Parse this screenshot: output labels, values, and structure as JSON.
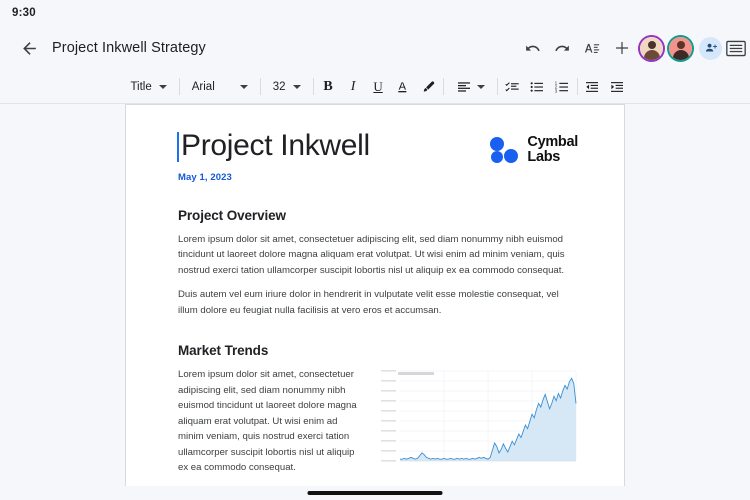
{
  "status_bar": {
    "time": "9:30"
  },
  "app_bar": {
    "back_icon": "back-arrow-icon",
    "title": "Project Inkwell Strategy",
    "actions": [
      {
        "name": "undo-button",
        "icon": "undo-icon"
      },
      {
        "name": "redo-button",
        "icon": "redo-icon"
      },
      {
        "name": "text-format-button",
        "icon": "text-format-icon"
      },
      {
        "name": "add-button",
        "icon": "plus-icon"
      }
    ],
    "collaborators": [
      {
        "name": "collaborator-avatar-1",
        "ring_color": "#9334c6"
      },
      {
        "name": "collaborator-avatar-2",
        "ring_color": "#0f9b8e"
      }
    ],
    "add_person": {
      "name": "add-person-button",
      "icon": "person-add-icon",
      "bg": "#d7e7fb"
    },
    "overflow": {
      "name": "document-outline-button",
      "icon": "list-menu-icon"
    }
  },
  "format_toolbar": {
    "style_select": {
      "value": "Title"
    },
    "font_select": {
      "value": "Arial"
    },
    "size_select": {
      "value": "32"
    },
    "buttons": [
      {
        "name": "bold-button",
        "label": "B"
      },
      {
        "name": "italic-button",
        "label": "I"
      },
      {
        "name": "underline-button",
        "label": "U"
      },
      {
        "name": "text-color-button",
        "label": "A"
      },
      {
        "name": "highlight-button",
        "label": "highlighter-icon"
      },
      {
        "name": "align-button",
        "label": "align-left-icon"
      },
      {
        "name": "checklist-button",
        "label": "checklist-icon"
      },
      {
        "name": "bulleted-list-button",
        "label": "bulleted-list-icon"
      },
      {
        "name": "numbered-list-button",
        "label": "numbered-list-icon"
      },
      {
        "name": "decrease-indent-button",
        "label": "decrease-indent-icon"
      },
      {
        "name": "increase-indent-button",
        "label": "increase-indent-icon"
      }
    ]
  },
  "document": {
    "heading": "Project Inkwell",
    "date": "May 1, 2023",
    "logo": {
      "text_line1": "Cymbal",
      "text_line2": "Labs",
      "color": "#1a60f0"
    },
    "sections": [
      {
        "heading": "Project Overview",
        "paragraphs": [
          "Lorem ipsum dolor sit amet, consectetuer adipiscing elit, sed diam nonummy nibh euismod tincidunt ut laoreet dolore magna aliquam erat volutpat. Ut wisi enim ad minim veniam, quis nostrud exerci tation ullamcorper suscipit lobortis nisl ut aliquip ex ea commodo consequat.",
          "Duis autem vel eum iriure dolor in hendrerit in vulputate velit esse molestie consequat, vel illum dolore eu feugiat nulla facilisis at vero eros et accumsan."
        ]
      },
      {
        "heading": "Market Trends",
        "paragraphs": [
          "Lorem ipsum dolor sit amet, consectetuer adipiscing elit, sed diam nonummy nibh euismod tincidunt ut laoreet dolore magna aliquam erat volutpat. Ut wisi enim ad minim veniam, quis nostrud exerci tation ullamcorper suscipit lobortis nisl ut aliquip ex ea commodo consequat."
        ]
      }
    ]
  },
  "chart_data": {
    "type": "area",
    "title": "",
    "xlabel": "",
    "ylabel": "",
    "grid": true,
    "legend_position": "top-left",
    "line_color": "#3b8fd4",
    "fill_color": "#cfe4f5",
    "x": [
      0,
      1,
      2,
      3,
      4,
      5,
      6,
      7,
      8,
      9,
      10,
      11,
      12,
      13,
      14,
      15,
      16,
      17,
      18,
      19,
      20,
      21,
      22,
      23,
      24,
      25,
      26,
      27,
      28,
      29,
      30,
      31,
      32,
      33,
      34,
      35,
      36,
      37,
      38,
      39,
      40,
      41,
      42,
      43,
      44,
      45,
      46,
      47,
      48,
      49,
      50,
      51,
      52,
      53,
      54,
      55,
      56,
      57,
      58,
      59,
      60,
      61,
      62,
      63,
      64,
      65,
      66,
      67,
      68,
      69,
      70,
      71,
      72,
      73,
      74,
      75,
      76,
      77,
      78,
      79,
      80
    ],
    "values": [
      2,
      2,
      3,
      2,
      3,
      4,
      3,
      2,
      3,
      6,
      9,
      7,
      4,
      3,
      2,
      3,
      2,
      3,
      2,
      2,
      3,
      2,
      2,
      3,
      2,
      2,
      3,
      2,
      3,
      2,
      3,
      2,
      2,
      3,
      2,
      3,
      4,
      3,
      4,
      3,
      2,
      4,
      12,
      20,
      16,
      9,
      13,
      19,
      14,
      10,
      16,
      22,
      18,
      24,
      30,
      26,
      33,
      40,
      36,
      44,
      52,
      48,
      57,
      64,
      60,
      68,
      74,
      66,
      58,
      64,
      72,
      67,
      75,
      70,
      78,
      84,
      80,
      88,
      92,
      86,
      64
    ],
    "ylim": [
      0,
      100
    ]
  },
  "home_indicator": {
    "name": "home-indicator"
  }
}
